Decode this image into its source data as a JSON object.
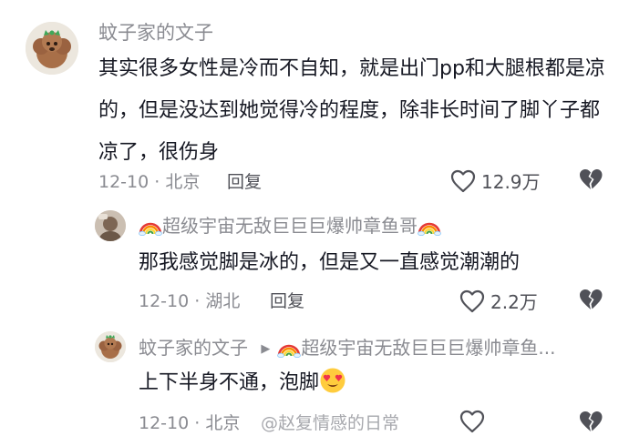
{
  "comments": [
    {
      "username": "蚊子家的文子",
      "text": "其实很多女性是冷而不自知，就是出门pp和大腿根都是凉的，但是没达到她觉得冷的程度，除非长时间了脚丫子都凉了，很伤身",
      "date_location": "12-10 · 北京",
      "reply_label": "回复",
      "likes": "12.9万"
    },
    {
      "username": "超级宇宙无敌巨巨巨爆帅章鱼哥",
      "text": "那我感觉脚是冰的，但是又一直感觉潮潮的",
      "date_location": "12-10 · 湖北",
      "reply_label": "回复",
      "likes": "2.2万"
    },
    {
      "username": "蚊子家的文子",
      "reply_to": "超级宇宙无敌巨巨巨爆帅章鱼...",
      "text": "上下半身不通，泡脚",
      "date_location": "12-10 · 北京",
      "reply_label": "回复",
      "watermark": "@赵复情感的日常"
    }
  ],
  "colors": {
    "username": "#8a8b91",
    "text": "#161823",
    "meta": "#8a8b91",
    "action": "#505158"
  },
  "icons": [
    "avatar-poodle",
    "avatar-user",
    "rainbow-icon",
    "heart-icon",
    "broken-heart-icon",
    "heart-eyes-emoji",
    "reply-arrow-icon"
  ]
}
